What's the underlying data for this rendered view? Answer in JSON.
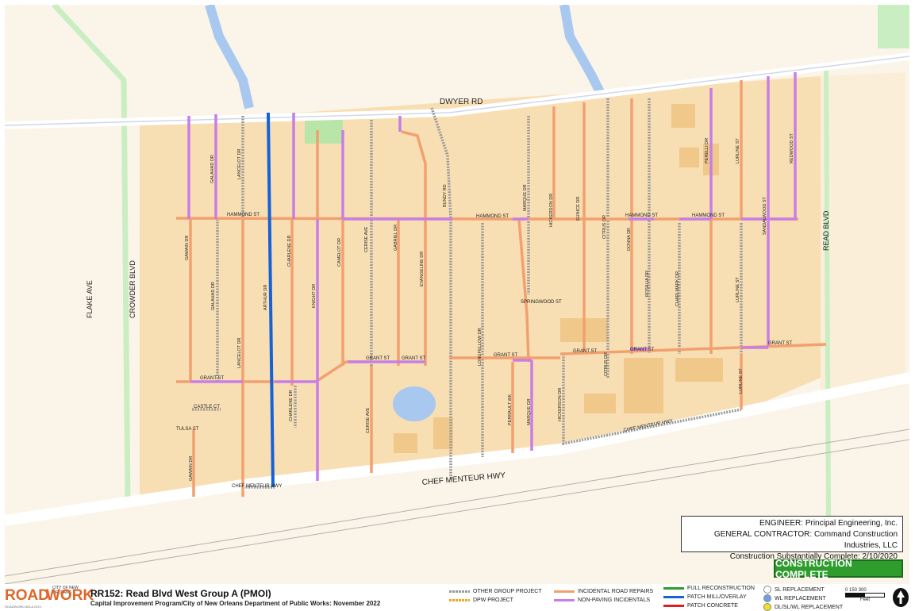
{
  "streets": {
    "dwyer": "DWYER RD",
    "chef_menteur_hwy": "CHEF MENTEUR HWY",
    "chef_menteur_hwy_small": "CHEF MENTEUR HWY",
    "chef_menteur_hwy_right": "CHEF MENTEUR HWY",
    "read_blvd": "READ BLVD",
    "crowder_blvd": "CROWDER BLVD",
    "flake_ave": "FLAKE AVE",
    "hammond_1": "HAMMOND ST",
    "hammond_2": "HAMMOND ST",
    "hammond_3": "HAMMOND ST",
    "hammond_4": "HAMMOND ST",
    "grant_1": "GRANT ST",
    "grant_2": "GRANT ST",
    "grant_3": "GRANT ST",
    "grant_4": "GRANT ST",
    "grant_5": "GRANT ST",
    "grant_6": "GRANT ST",
    "grant_7": "GRANT ST",
    "springwood": "SPRINGWOOD ST",
    "castle": "CASTLE CT",
    "tulsa": "TULSA ST",
    "gawain_1": "GAWAIN DR",
    "gawain_2": "GAWAIN DR",
    "galahad_1": "GALAHAD DR",
    "galahad_2": "GALAHAD DR",
    "lancelot_1": "LANCELOT DR",
    "lancelot_2": "LANCELOT DR",
    "arthur": "ARTHUR DR",
    "charlene_1": "CHARLENE DR",
    "charlene_2": "CHARLENE DR",
    "knight": "KNIGHT DR",
    "camelot": "CAMELOT DR",
    "cerise_1": "CERISE AVE",
    "cerise_2": "CERISE AVE",
    "gabriel": "GABRIEL DR",
    "evangeline": "EVANGELINE DR",
    "bundy": "BUNDY RD",
    "longfellow": "LONGFELLOW DR",
    "marque_1": "MARQUE DR",
    "marque_2": "MARQUE DR",
    "perrault": "PERRAULT WK",
    "hickerson_1": "HICKERSON DR",
    "hickerson_2": "HICKERSON DR",
    "eunice": "EUNICE DR",
    "citrus_1": "CITRUS DR",
    "citrus_2": "CITRUS DR",
    "donna": "DONNA DR",
    "rosalia": "ROSALIA DR",
    "charlmark": "CHARLMARK DR",
    "perelli": "PERELLI DR",
    "lurline_1": "LURLINE ST",
    "lurline_2": "LURLINE ST",
    "lurline_3": "LURLINE ST",
    "sandalwood": "SANDALWOOD ST",
    "redwood": "REDWOOD ST"
  },
  "info": {
    "engineer": "ENGINEER:  Principal Engineering, Inc.",
    "contractor": "GENERAL CONTRACTOR:  Command Construction Industries, LLC",
    "complete_date": "Construction Substantially Complete:  2/10/2020"
  },
  "status_badge": "CONSTRUCTION COMPLETE",
  "footer": {
    "logo_road": "ROAD",
    "logo_work": "WORK",
    "logo_city": "CITY OF NEW ORLEANS",
    "logo_tag": "ROADWORK.NOLA.GOV",
    "title": "RR152:  Read Blvd West Group A (PMOI)",
    "subtitle": "Capital Improvement Program/City of New Orleans Department of Public Works:  November 2022"
  },
  "legend": {
    "other_group": "OTHER GROUP PROJECT",
    "dpw": "DPW PROJECT",
    "incidental_road": "INCIDENTAL ROAD REPAIRS",
    "non_paving": "NON-PAVING INCIDENTALS",
    "full_recon": "FULL RECONSTRUCTION",
    "patch_mill": "PATCH MILL/OVERLAY",
    "patch_concrete": "PATCH CONCRETE",
    "sl_replacement": "SL REPLACEMENT",
    "wl_replacement": "WL REPLACEMENT",
    "dl_replacement": "DL/SL/WL REPLACEMENT"
  },
  "scale": {
    "ticks": "0     150   300",
    "unit": "Feet"
  },
  "colors": {
    "orange": "#f2a070",
    "purple": "#c77ee6",
    "blue": "#1561d8",
    "gray": "#9a9a9a",
    "green": "#2e9d2e",
    "red": "#e02020",
    "yellow_dpw": "#f5a623"
  }
}
